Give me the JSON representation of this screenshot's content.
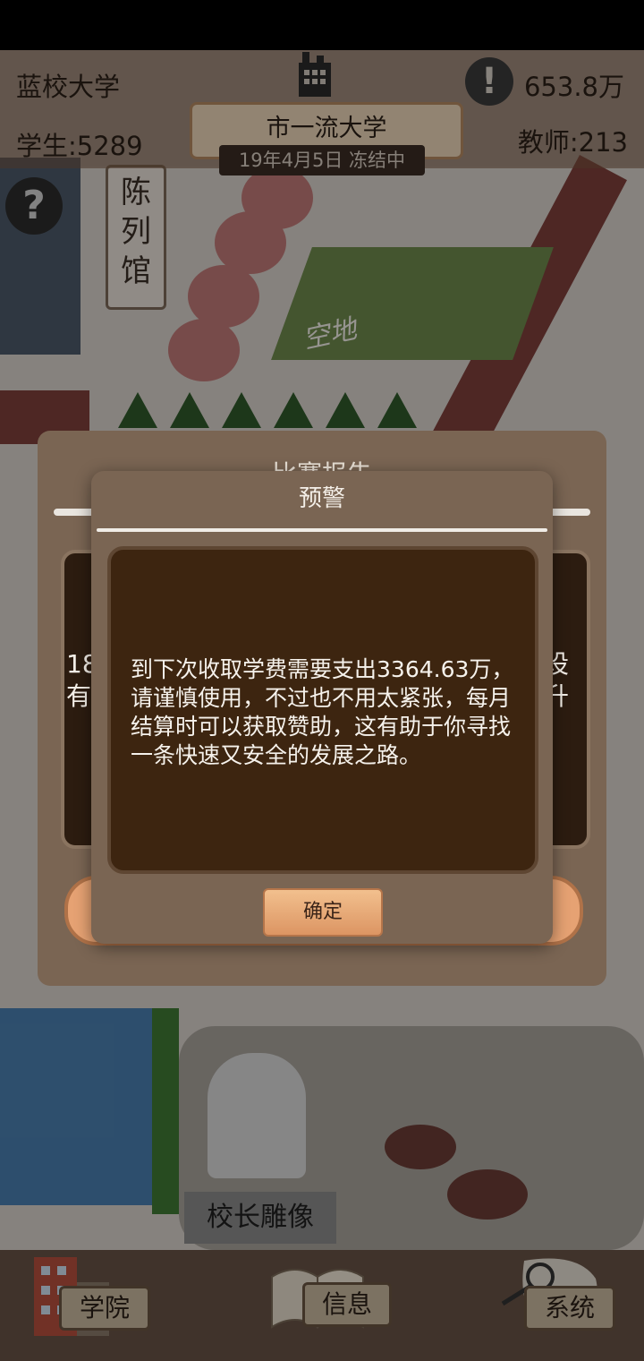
{
  "header": {
    "university_name": "蓝校大学",
    "students": "学生:5289",
    "teachers": "教师:213",
    "money": "653.8万",
    "rank_title": "市一流大学",
    "date_status": "19年4月5日 冻结中",
    "alert_icon": "!",
    "help_icon": "?"
  },
  "map": {
    "museum_label": "陈列馆",
    "empty_lot_label": "空地",
    "statue_label": "校长雕像"
  },
  "race_dialog": {
    "title": "比赛报告",
    "fragment_left": "18有。",
    "fragment_right": "设升"
  },
  "warning_dialog": {
    "title": "预警",
    "message": "到下次收取学费需要支出3364.63万，请谨慎使用，不过也不用太紧张，每月结算时可以获取赞助，这有助于你寻找一条快速又安全的发展之路。",
    "confirm_label": "确定"
  },
  "nav": {
    "college": "学院",
    "info": "信息",
    "system": "系统"
  },
  "colors": {
    "dialog_bg": "#7a6553",
    "dialog_body": "#3d2510",
    "button": "#e6a273"
  }
}
